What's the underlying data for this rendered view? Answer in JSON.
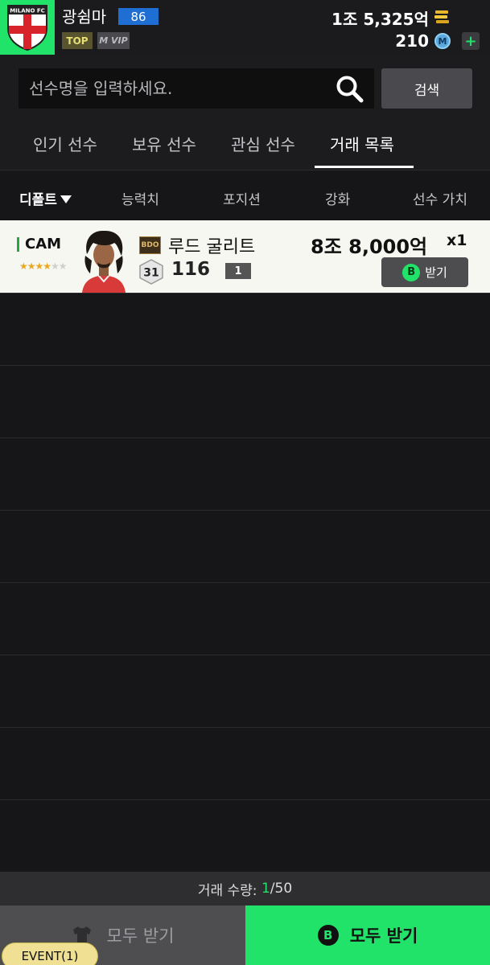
{
  "header": {
    "club_name": "MILANO FC",
    "user_name": "광쉼마",
    "level": "86",
    "top_badge": "TOP",
    "vip_badge": "VIP",
    "currency": "1조 5,325억",
    "points": "210",
    "points_icon": "M"
  },
  "search": {
    "placeholder": "선수명을 입력하세요.",
    "button": "검색"
  },
  "tabs": [
    {
      "label": "인기 선수"
    },
    {
      "label": "보유 선수"
    },
    {
      "label": "관심 선수"
    },
    {
      "label": "거래 목록",
      "active": true
    }
  ],
  "sort": {
    "default": "디폴트",
    "ability": "능력치",
    "position": "포지션",
    "enhance": "강화",
    "value": "선수 가치"
  },
  "trades": [
    {
      "position": "CAM",
      "stars_filled": 4,
      "stars_total": 6,
      "season": "BDO",
      "name": "루드 굴리트",
      "grade": "31",
      "ovr": "116",
      "enhance": "1",
      "price": "8조 8,000억",
      "quantity": "x1",
      "receive_icon": "B",
      "receive_label": "받기"
    }
  ],
  "footer": {
    "count_label": "거래 수량:",
    "count_current": "1",
    "count_total": "/50",
    "claim_all_disabled": "모두 받기",
    "claim_all_active": "모두 받기",
    "claim_icon": "B",
    "event_badge": "EVENT(1)"
  },
  "colors": {
    "accent": "#21e36a",
    "background": "#161618",
    "row_highlight": "#f7f7f1"
  }
}
